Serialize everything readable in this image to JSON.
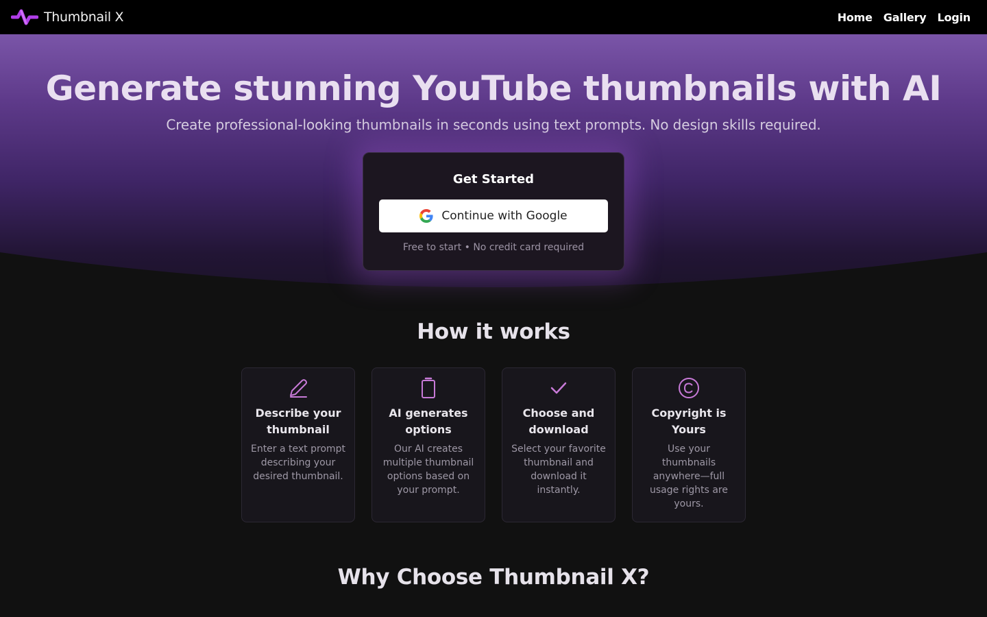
{
  "nav": {
    "brand_name": "Thumbnail X",
    "links": [
      {
        "label": "Home"
      },
      {
        "label": "Gallery"
      },
      {
        "label": "Login"
      }
    ]
  },
  "hero": {
    "title": "Generate stunning YouTube thumbnails with AI",
    "subtitle": "Create professional-looking thumbnails in seconds using text prompts. No design skills required."
  },
  "get_started": {
    "title": "Get Started",
    "google_button_label": "Continue with Google",
    "note": "Free to start • No credit card required"
  },
  "how_it_works": {
    "title": "How it works",
    "steps": [
      {
        "icon": "pencil-icon",
        "title": "Describe your thumbnail",
        "description": "Enter a text prompt describing your desired thumbnail."
      },
      {
        "icon": "clipboard-icon",
        "title": "AI generates options",
        "description": "Our AI creates multiple thumbnail options based on your prompt."
      },
      {
        "icon": "check-icon",
        "title": "Choose and download",
        "description": "Select your favorite thumbnail and download it instantly."
      },
      {
        "icon": "copyright-icon",
        "title": "Copyright is Yours",
        "description": "Use your thumbnails anywhere—full usage rights are yours."
      }
    ]
  },
  "why": {
    "title": "Why Choose Thumbnail X?"
  },
  "colors": {
    "accent": "#c87ad8",
    "logo": "#b03ee8",
    "hero_top": "#7a55a8",
    "background": "#111111"
  }
}
